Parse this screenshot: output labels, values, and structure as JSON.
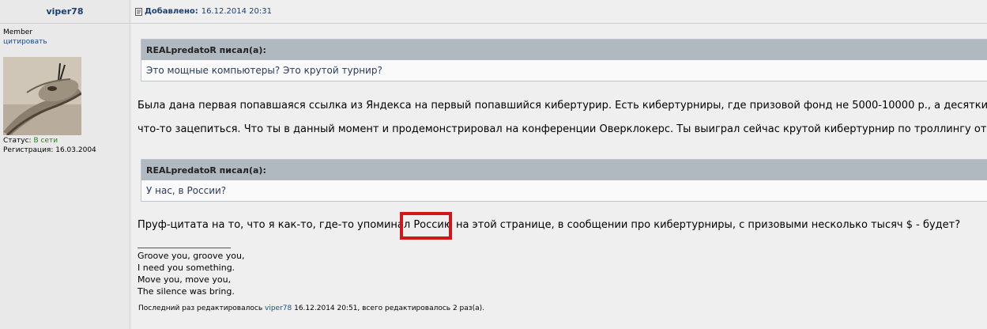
{
  "author": {
    "name": "viper78",
    "rank": "Member",
    "quote_label": "цитировать",
    "status_label": "Статус:",
    "status_value": "В сети",
    "registration": "Регистрация: 16.03.2004"
  },
  "post": {
    "added_label": "Добавлено:",
    "date": "16.12.2014 20:31",
    "quote1": {
      "author": "REALpredatoR писал(а):",
      "text": "Это мощные компьютеры? Это крутой турнир?"
    },
    "para1": "Была дана первая попавшаяся ссылка из Яндекса на первый попавшийся кибертурир. Есть кибертурниры, где призовой фонд не 5000-10000 р., а десятки ты",
    "para2": "что-то зацепиться. Что ты в данный момент и продемонстрировал на конференции Оверклокерс. Ты выиграл сейчас крутой кибертурнир по троллингу от риа",
    "quote2": {
      "author": "REALpredatoR писал(а):",
      "text": "У нас, в России?"
    },
    "para3": "Пруф-цитата на то, что я как-то, где-то упоминал Россию на этой странице, в сообщении про кибертурниры, с призовыми несколько тысяч $ - будет?",
    "signature": [
      "Groove you, groove you,",
      "I need you something.",
      "Move you, move you,",
      "The silence was bring."
    ],
    "edited_prefix": "Последний раз редактировалось",
    "edited_user": "viper78",
    "edited_suffix": "16.12.2014 20:51, всего редактировалось 2 раз(а)."
  },
  "colors": {
    "highlight": "#d01818",
    "link": "#1c4a8a",
    "online": "#1f8a1f"
  }
}
